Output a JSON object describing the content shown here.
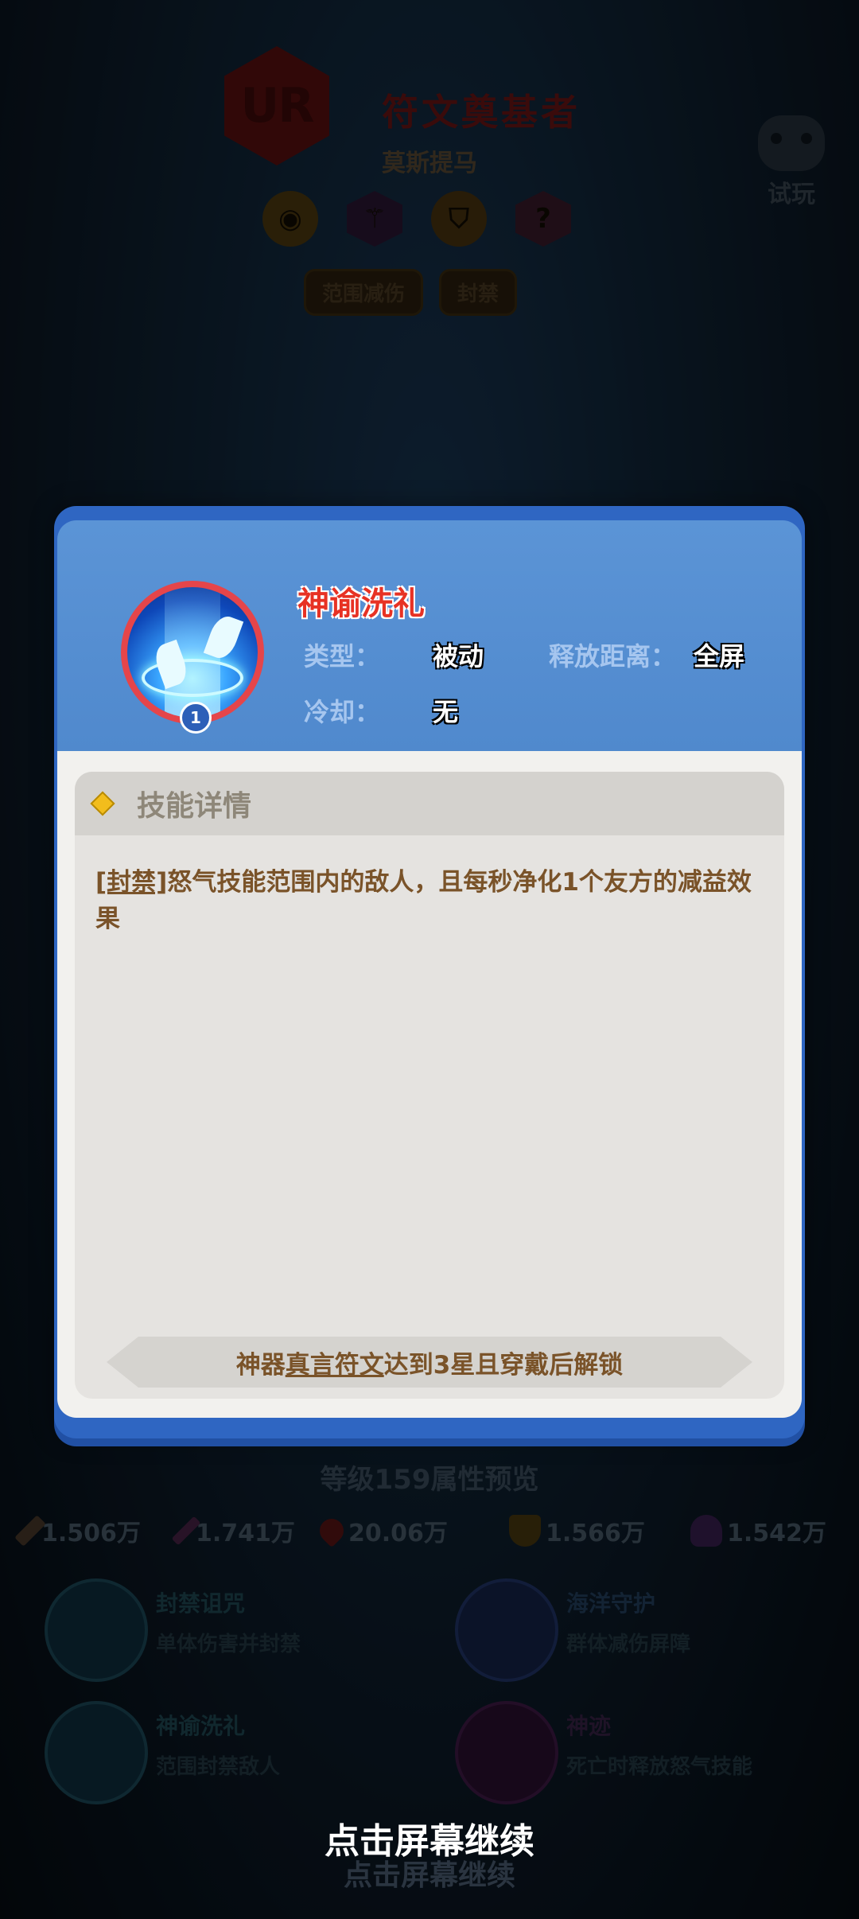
{
  "hero": {
    "rarity": "UR",
    "name": "符文奠基者",
    "subtitle": "莫斯提马",
    "attribute_icons": [
      "eye-icon",
      "bow-icon",
      "shield-icon",
      "rune-icon"
    ],
    "tags": [
      "范围减伤",
      "封禁"
    ]
  },
  "trial": {
    "label": "试玩",
    "icon": "gamepad-icon"
  },
  "dialog": {
    "skill_name": "神谕洗礼",
    "skill_level": "1",
    "type_label": "类型：",
    "type_value": "被动",
    "range_label": "释放距离：",
    "range_value": "全屏",
    "cooldown_label": "冷却：",
    "cooldown_value": "无",
    "section_title": "技能详情",
    "desc_tag": "[封禁]",
    "desc_text": "怒气技能范围内的敌人，且每秒净化1个友方的减益效果",
    "unlock_prefix": "神器",
    "unlock_key": "真言符文",
    "unlock_suffix": "达到3星且穿戴后解锁",
    "colors": {
      "header": "#5089cd",
      "name": "#e73224",
      "desc": "#7a5329"
    }
  },
  "preview": {
    "title": "等级159属性预览",
    "stats": [
      {
        "icon": "sword-icon",
        "value": "1.506万"
      },
      {
        "icon": "staff-icon",
        "value": "1.741万"
      },
      {
        "icon": "heart-icon",
        "value": "20.06万"
      },
      {
        "icon": "shield-icon",
        "value": "1.566万"
      },
      {
        "icon": "potion-icon",
        "value": "1.542万"
      }
    ]
  },
  "skills": [
    {
      "name": "封禁诅咒",
      "desc": "单体伤害并封禁"
    },
    {
      "name": "海洋守护",
      "desc": "群体减伤屏障"
    },
    {
      "name": "神谕洗礼",
      "desc": "范围封禁敌人"
    },
    {
      "name": "神迹",
      "desc": "死亡时释放怒气技能"
    }
  ],
  "continue_text": "点击屏幕继续"
}
